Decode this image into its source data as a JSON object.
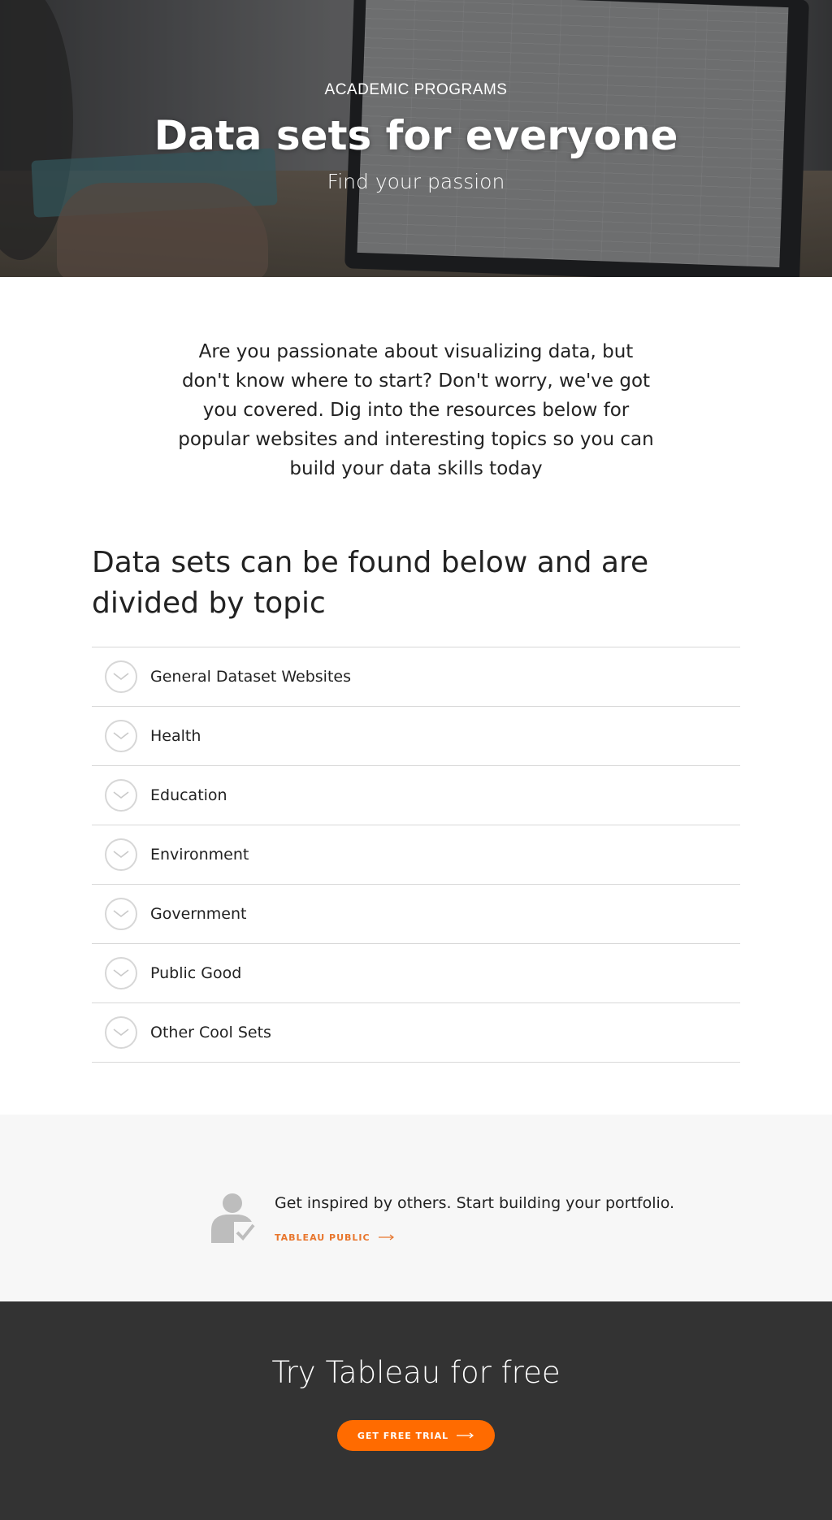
{
  "hero": {
    "eyebrow": "ACADEMIC PROGRAMS",
    "title": "Data sets for everyone",
    "subtitle": "Find your passion"
  },
  "intro": {
    "text": "Are you passionate about visualizing data, but don't know where to start? Don't worry, we've got you covered. Dig into the resources below for popular websites and interesting topics so you can build your data skills today"
  },
  "topics": {
    "heading": "Data sets can be found below and are divided by topic",
    "items": [
      {
        "label": "General Dataset Websites",
        "icon": "chevron-down-icon"
      },
      {
        "label": "Health",
        "icon": "chevron-down-icon"
      },
      {
        "label": "Education",
        "icon": "chevron-down-icon"
      },
      {
        "label": "Environment",
        "icon": "chevron-down-icon"
      },
      {
        "label": "Government",
        "icon": "chevron-down-icon"
      },
      {
        "label": "Public Good",
        "icon": "chevron-down-icon"
      },
      {
        "label": "Other Cool Sets",
        "icon": "chevron-down-icon"
      }
    ]
  },
  "inspire": {
    "text": "Get inspired by others. Start building your portfolio.",
    "link_label": "TABLEAU PUBLIC",
    "icon": "person-check-icon",
    "link_color": "#e8762d"
  },
  "cta": {
    "title": "Try Tableau for free",
    "button_label": "GET FREE TRIAL",
    "button_color": "#ff6b00",
    "background": "#333333"
  }
}
